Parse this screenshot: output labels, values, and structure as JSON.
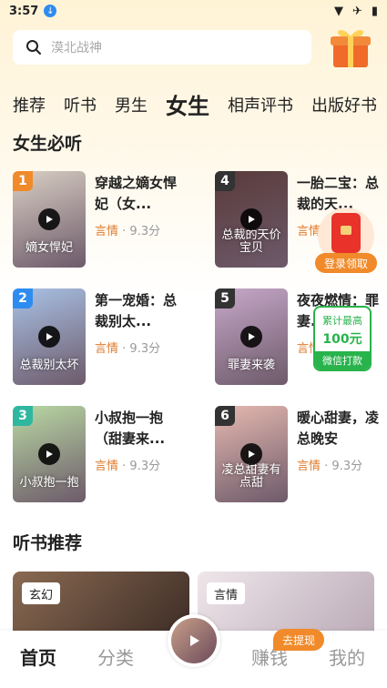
{
  "status_bar": {
    "time": "3:57"
  },
  "search": {
    "placeholder": "漠北战神"
  },
  "tabs": [
    "推荐",
    "听书",
    "男生",
    "女生",
    "相声评书",
    "出版好书"
  ],
  "active_tab": "女生",
  "section_female": {
    "title": "女生必听"
  },
  "books": [
    {
      "rank": "1",
      "title": "穿越之嫡女悍妃（女...",
      "category": "言情",
      "score": "· 9.3分",
      "cover_text": "嫡女悍妃",
      "cover_color": "#d9cfc4",
      "rank_color": "#f08a2a"
    },
    {
      "rank": "4",
      "title": "一胎二宝：总裁的天...",
      "category": "言情",
      "score": "· 9.3分",
      "cover_text": "总裁的天价宝贝",
      "cover_color": "#5a3b3b",
      "rank_color": "#333333"
    },
    {
      "rank": "2",
      "title": "第一宠婚：总裁别太...",
      "category": "言情",
      "score": "· 9.3分",
      "cover_text": "总裁别太坏",
      "cover_color": "#a9c2e6",
      "rank_color": "#2e8cf0"
    },
    {
      "rank": "5",
      "title": "夜夜燃情：罪妻...",
      "category": "言情",
      "score": "· 9.3分",
      "cover_text": "罪妻来袭",
      "cover_color": "#c7a8c9",
      "rank_color": "#333333"
    },
    {
      "rank": "3",
      "title": "小叔抱一抱（甜妻来...",
      "category": "言情",
      "score": "· 9.3分",
      "cover_text": "小叔抱一抱",
      "cover_color": "#b9d9a3",
      "rank_color": "#2fb7a0"
    },
    {
      "rank": "6",
      "title": "暖心甜妻，凌总晚安",
      "category": "言情",
      "score": "· 9.3分",
      "cover_text": "凌总甜妻有点甜",
      "cover_color": "#e6b9b0",
      "rank_color": "#333333"
    }
  ],
  "float_redpack": {
    "label": "登录领取"
  },
  "float_wechat": {
    "top": "累计最高",
    "amount": "100元",
    "bottom": "微信打款"
  },
  "section_audio": {
    "title": "听书推荐"
  },
  "recommend": [
    {
      "tag": "玄幻",
      "color": "#6a4b3a"
    },
    {
      "tag": "言情",
      "color": "#d9cfd6"
    }
  ],
  "bottom_nav": {
    "home": "首页",
    "category": "分类",
    "earn": "赚钱",
    "mine": "我的",
    "badge": "去提现"
  },
  "colors": {
    "accent": "#e07b2c",
    "wechat_green": "#28b34b",
    "orange": "#f08a2a"
  }
}
